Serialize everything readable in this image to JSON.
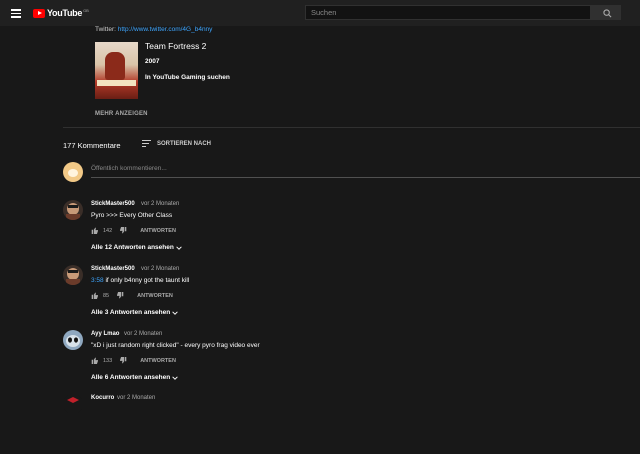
{
  "header": {
    "logo_text": "YouTube",
    "logo_region": "GB",
    "search_placeholder": "Suchen"
  },
  "description": {
    "twitter_label": "Twitter:",
    "twitter_link": "http://www.twitter.com/4G_b4nny"
  },
  "game": {
    "title": "Team Fortress 2",
    "year": "2007",
    "link": "In YouTube Gaming suchen"
  },
  "show_more": "MEHR ANZEIGEN",
  "comments_header": {
    "count": "177 Kommentare",
    "sort": "SORTIEREN NACH"
  },
  "add_comment_placeholder": "Öffentlich kommentieren...",
  "comments": [
    {
      "author": "StickMaster500",
      "time": "vor 2 Monaten",
      "timestamp_link": "",
      "text": "Pyro >>> Every Other Class",
      "likes": "142",
      "reply": "ANTWORTEN",
      "replies": "Alle 12 Antworten ansehen"
    },
    {
      "author": "StickMaster500",
      "time": "vor 2 Monaten",
      "timestamp_link": "3:58",
      "text": " if only b4nny got the taunt kill",
      "likes": "85",
      "reply": "ANTWORTEN",
      "replies": "Alle 3 Antworten ansehen"
    },
    {
      "author": "Ayy Lmao",
      "time": "vor 2 Monaten",
      "timestamp_link": "",
      "text": "\"xD i just random right clicked\" - every pyro frag video ever",
      "likes": "133",
      "reply": "ANTWORTEN",
      "replies": "Alle 6 Antworten ansehen"
    },
    {
      "author": "Kocurro",
      "time": "vor 2 Monaten"
    }
  ],
  "colors": {
    "background": "#181818",
    "topbar": "#202020",
    "link": "#3ea6ff",
    "brand_red": "#ff0000"
  }
}
